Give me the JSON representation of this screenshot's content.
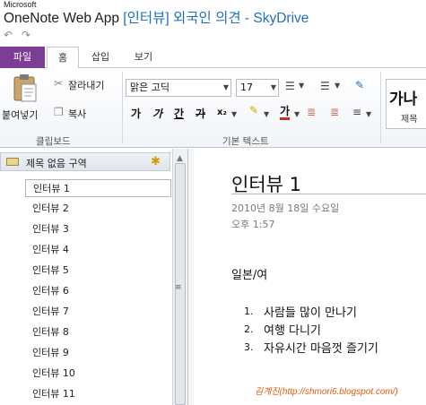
{
  "titlebar": {
    "brand": "Microsoft",
    "app_name": "OneNote Web App",
    "doc_title": "[인터뷰] 외국인 의견",
    "separator": " - ",
    "service": "SkyDrive"
  },
  "ribbon": {
    "tabs": [
      "파일",
      "홈",
      "삽입",
      "보기"
    ],
    "clipboard": {
      "paste_label": "붙여넣기",
      "cut_label": "잘라내기",
      "copy_label": "복사",
      "group_label": "클립보드"
    },
    "basic_text": {
      "font_name": "맑은 고딕",
      "font_size": "17",
      "bold": "가",
      "italic": "가",
      "underline": "간",
      "strike": "가",
      "subscript": "x₂",
      "font_color": "가",
      "group_label": "기본 텍스트"
    },
    "styles": {
      "preview": "가나",
      "label": "제목"
    }
  },
  "nav": {
    "section_label": "제목 없음 구역",
    "pages": [
      "인터뷰 1",
      "인터뷰 2",
      "인터뷰 3",
      "인터뷰 4",
      "인터뷰 5",
      "인터뷰 6",
      "인터뷰 7",
      "인터뷰 8",
      "인터뷰 9",
      "인터뷰 10",
      "인터뷰 11"
    ],
    "selected_index": 0
  },
  "page": {
    "title": "인터뷰 1",
    "date": "2010년 8월 18일 수요일",
    "time": "오후 1:57",
    "heading": "일본/여",
    "list": [
      {
        "num": "1.",
        "text": "사람들 많이 만나기"
      },
      {
        "num": "2.",
        "text": "여행 다니기"
      },
      {
        "num": "3.",
        "text": "자유시간 마음껏 즐기기"
      }
    ],
    "watermark": "김계진(http://shmori6.blogspot.com/)"
  },
  "colors": {
    "file_tab": "#7d3c95",
    "title_link": "#1f6fc5",
    "watermark": "#e05a10"
  }
}
